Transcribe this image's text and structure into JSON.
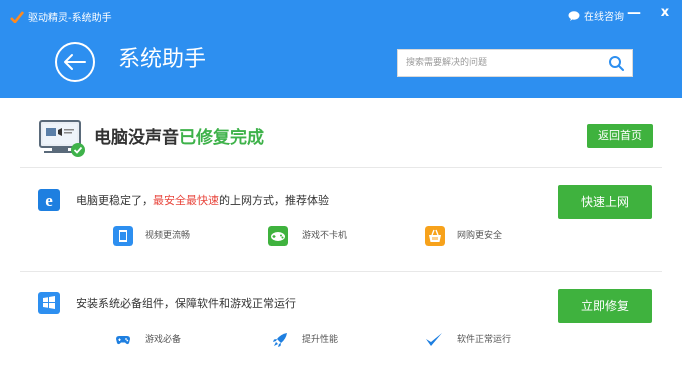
{
  "window": {
    "app_title": "驱动精灵-系统助手",
    "consult_label": "在线咨询",
    "minimize_glyph": "—",
    "close_glyph": "x"
  },
  "header": {
    "page_title": "系统助手",
    "search_placeholder": "搜索需要解决的问题"
  },
  "status": {
    "prefix": "电脑没声音",
    "result": "已修复完成",
    "home_button": "返回首页"
  },
  "sections": [
    {
      "icon": "ie-browser-icon",
      "text_before": "电脑更稳定了，",
      "text_highlight": "最安全最快速",
      "text_after": "的上网方式，推荐体验",
      "button": "快速上网",
      "features": [
        {
          "icon": "video-icon",
          "label": "视频更流畅"
        },
        {
          "icon": "gamepad-icon",
          "label": "游戏不卡机"
        },
        {
          "icon": "shopping-basket-icon",
          "label": "网购更安全"
        }
      ]
    },
    {
      "icon": "components-icon",
      "text": "安装系统必备组件，保障软件和游戏正常运行",
      "button": "立即修复",
      "features": [
        {
          "icon": "game-controller-icon",
          "label": "游戏必备"
        },
        {
          "icon": "rocket-icon",
          "label": "提升性能"
        },
        {
          "icon": "checkmark-icon",
          "label": "软件正常运行"
        }
      ]
    }
  ],
  "colors": {
    "header_blue": "#2d8ff0",
    "button_green": "#3fb23e",
    "success_green": "#3eb24a",
    "highlight_red": "#e8453c"
  }
}
